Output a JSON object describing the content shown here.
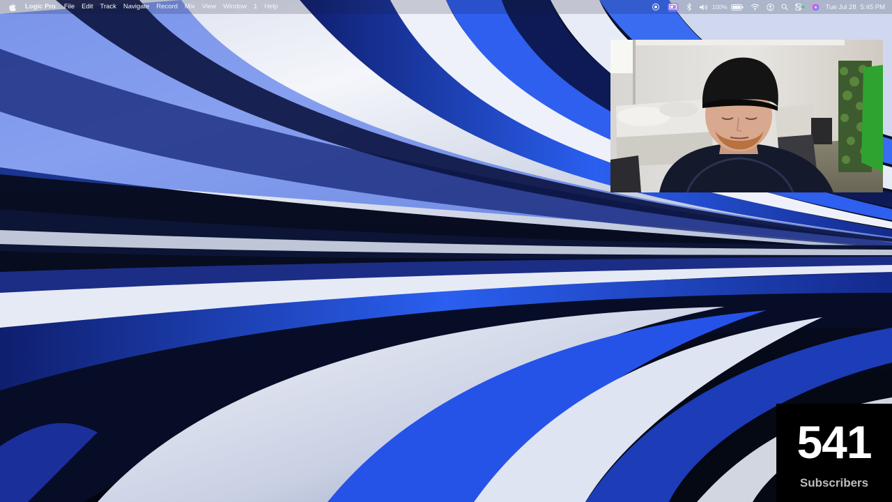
{
  "menubar": {
    "app_name": "Logic Pro",
    "items": [
      "File",
      "Edit",
      "Track",
      "Navigate",
      "Record",
      "Mix",
      "View",
      "Window",
      "1",
      "Help"
    ],
    "battery_percent": "100%",
    "date": "Tue Jul 28",
    "time": "5:45 PM",
    "tray_icons": [
      "screen-record-icon",
      "display-icon",
      "bluetooth-icon",
      "volume-icon",
      "battery-icon",
      "wifi-icon",
      "user-icon",
      "search-icon",
      "control-center-icon",
      "siri-icon"
    ]
  },
  "overlay": {
    "subscriber_count": "541",
    "subscriber_label": "Subscribers"
  },
  "colors": {
    "wallpaper_dark": "#070b1c",
    "wallpaper_blue": "#2450d8",
    "wallpaper_light": "#e4e9f5",
    "subs_bg": "#000000"
  }
}
